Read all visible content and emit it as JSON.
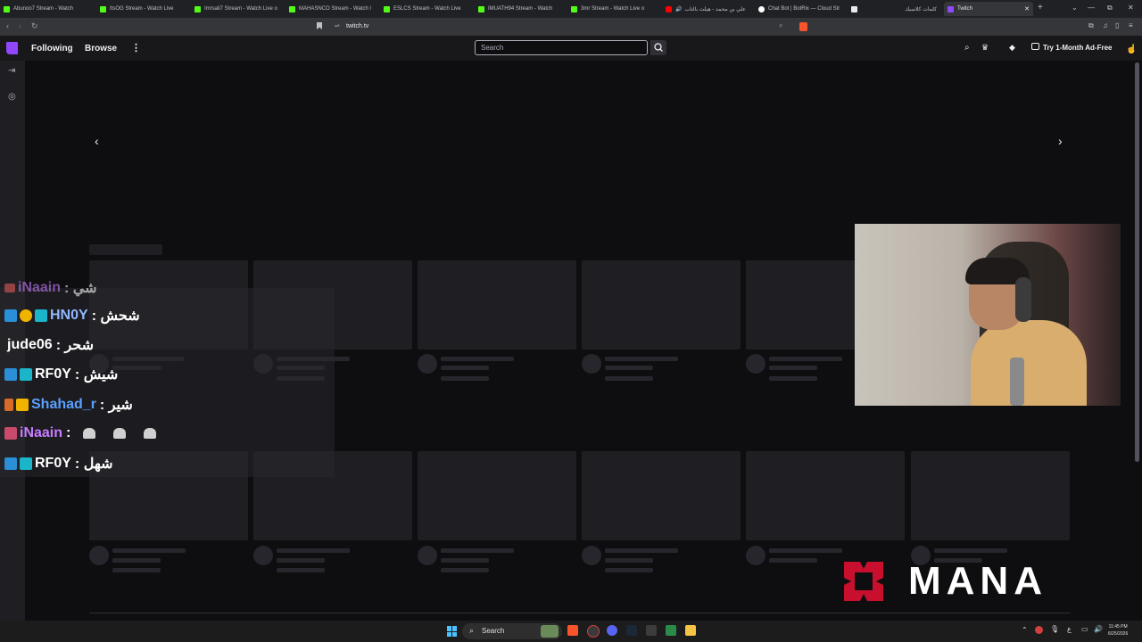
{
  "browser": {
    "tabs": [
      {
        "label": "Abunoo7 Stream - Watch",
        "favicon_color": "#53fc18"
      },
      {
        "label": "ItsOG Stream - Watch Live",
        "favicon_color": "#53fc18"
      },
      {
        "label": "Imrsali7 Stream - Watch Live o",
        "favicon_color": "#53fc18"
      },
      {
        "label": "MAHASNCO Stream - Watch l",
        "favicon_color": "#53fc18"
      },
      {
        "label": "ESLCS Stream - Watch Live",
        "favicon_color": "#53fc18"
      },
      {
        "label": "IMUATH94 Stream - Watch",
        "favicon_color": "#53fc18"
      },
      {
        "label": "3mr Stream - Watch Live o",
        "favicon_color": "#53fc18"
      },
      {
        "label": "علي بن محمد - هيلث بالتاب",
        "favicon_color": "#ff0000"
      },
      {
        "label": "Chat Bot | BotRix — Cloud Str",
        "favicon_color": "#ffffff"
      },
      {
        "label": "",
        "favicon_color": "#e8eaed"
      },
      {
        "label": "كلمات كلاسيك",
        "favicon_color": ""
      },
      {
        "label": "Twitch",
        "favicon_color": "#9146ff"
      }
    ],
    "url": "twitch.tv",
    "new_tab_glyph": "+",
    "window_controls": [
      "⌄",
      "—",
      "⧉",
      "✕"
    ]
  },
  "twitch": {
    "nav": {
      "following": "Following",
      "browse": "Browse",
      "more": "⋮"
    },
    "search_placeholder": "Search",
    "ad_free_label": "Try 1-Month Ad-Free",
    "carousel_prev": "‹",
    "carousel_next": "›"
  },
  "chat": [
    {
      "user": "iNaain",
      "message": ": شي",
      "color": "#c77dff"
    },
    {
      "user": "HN0Y",
      "message": ": شحش",
      "color": "#8fb8ff"
    },
    {
      "user": "jude06",
      "message": ": شحر",
      "color": "#ffffff"
    },
    {
      "user": "RF0Y",
      "message": ": شيش",
      "color": "#ffffff"
    },
    {
      "user": "Shahad_r",
      "message": ": شير",
      "color": "#5aa0ff"
    },
    {
      "user": "iNaain",
      "message": ":",
      "color": "#c77dff"
    },
    {
      "user": "RF0Y",
      "message": ": شهل",
      "color": "#ffffff"
    }
  ],
  "overlay": {
    "logo_text": "MANA",
    "logo_color": "#c8102e"
  },
  "taskbar": {
    "search_label": "Search",
    "time": "11:45 PM",
    "date": "6/25/2026"
  }
}
